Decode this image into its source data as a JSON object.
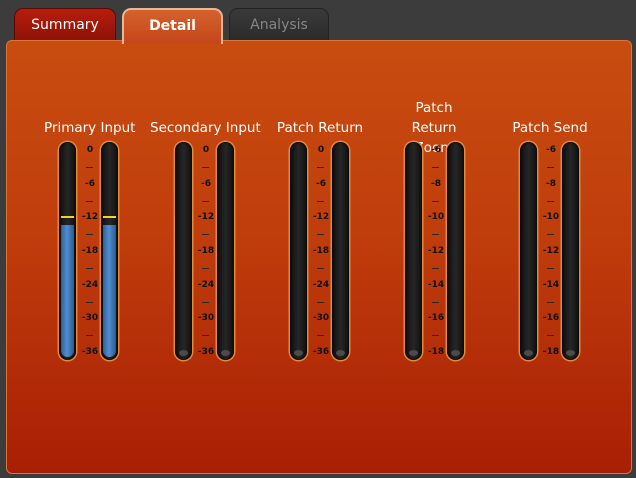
{
  "tabs": [
    {
      "label": "Summary",
      "state": "inactive"
    },
    {
      "label": "Detail",
      "state": "active"
    },
    {
      "label": "Analysis",
      "state": "disabled"
    }
  ],
  "meters": [
    {
      "title": "Primary Input",
      "scale": [
        "0",
        "-6",
        "-12",
        "-18",
        "-24",
        "-30",
        "-36"
      ],
      "scale_min": -36,
      "scale_max": 0,
      "left_level_db": -13.5,
      "right_level_db": -13.5,
      "left_peak_db": -12.4,
      "right_peak_db": -12.4
    },
    {
      "title": "Secondary Input",
      "scale": [
        "0",
        "-6",
        "-12",
        "-18",
        "-24",
        "-30",
        "-36"
      ],
      "scale_min": -36,
      "scale_max": 0,
      "left_level_db": null,
      "right_level_db": null
    },
    {
      "title": "Patch Return",
      "scale": [
        "0",
        "-6",
        "-12",
        "-18",
        "-24",
        "-30",
        "-36"
      ],
      "scale_min": -36,
      "scale_max": 0,
      "left_level_db": null,
      "right_level_db": null
    },
    {
      "title": "Patch Return Zoom",
      "scale": [
        "-6",
        "-8",
        "-10",
        "-12",
        "-14",
        "-16",
        "-18"
      ],
      "scale_min": -18,
      "scale_max": -6,
      "left_level_db": null,
      "right_level_db": null
    },
    {
      "title": "Patch Send",
      "scale": [
        "-6",
        "-8",
        "-10",
        "-12",
        "-14",
        "-16",
        "-18"
      ],
      "scale_min": -18,
      "scale_max": -6,
      "left_level_db": null,
      "right_level_db": null
    }
  ],
  "colors": {
    "meter_fill": "#4f8fcf",
    "peak": "#f2d321",
    "panel": "#c03d0c"
  }
}
